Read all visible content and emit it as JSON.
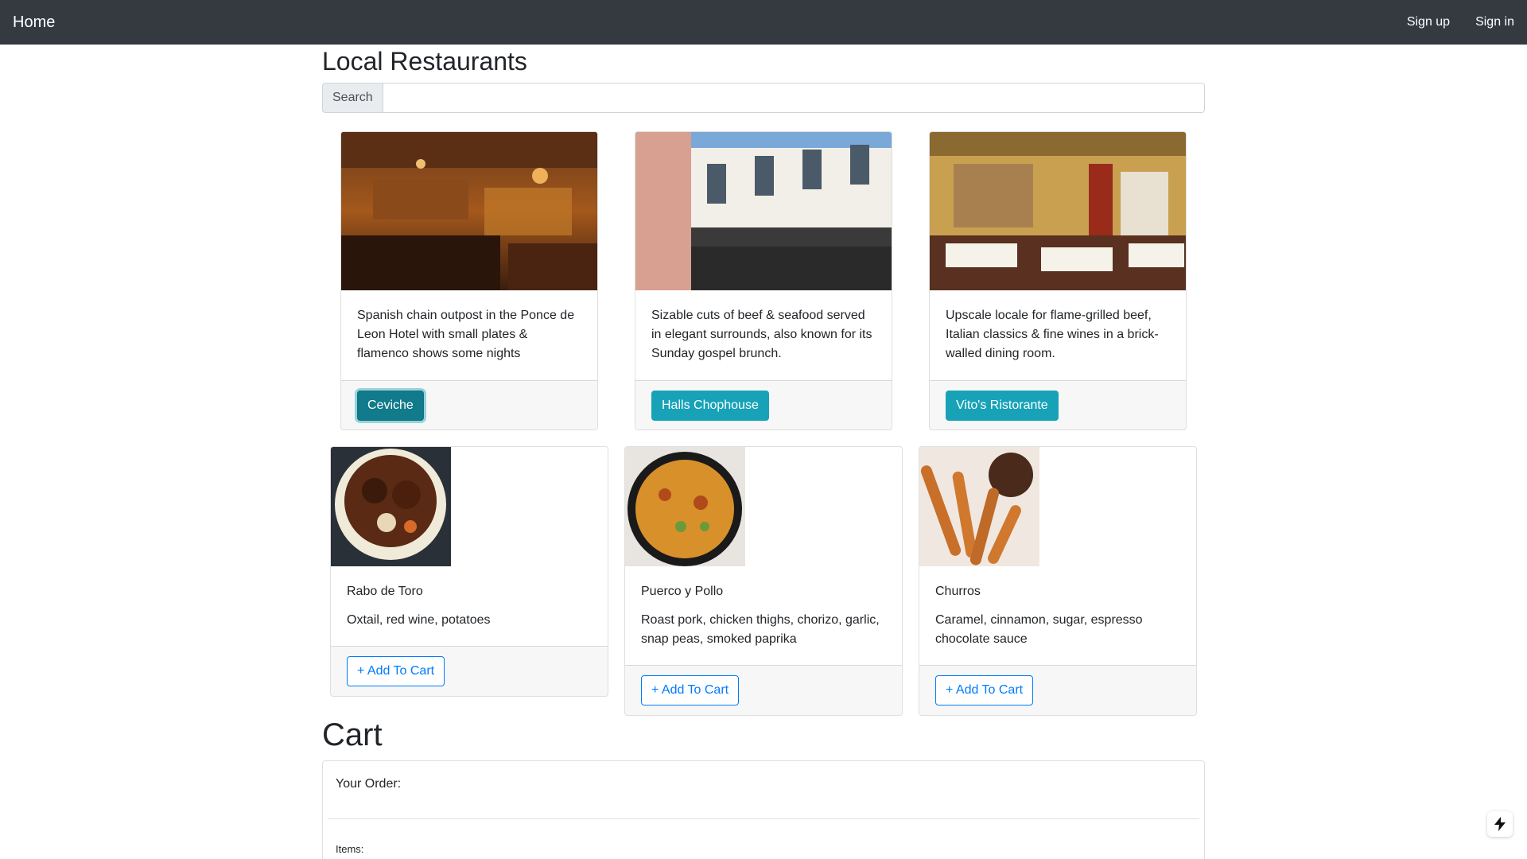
{
  "navbar": {
    "brand": "Home",
    "signup": "Sign up",
    "signin": "Sign in"
  },
  "page": {
    "title": "Local Restaurants"
  },
  "search": {
    "label": "Search",
    "placeholder": "",
    "value": ""
  },
  "restaurants": [
    {
      "image": "restaurant-bar-interior",
      "description": "Spanish chain outpost in the Ponce de Leon Hotel with small plates & flamenco shows some nights",
      "button": "Ceviche"
    },
    {
      "image": "chophouse-storefront",
      "description": "Sizable cuts of beef & seafood served in elegant surrounds, also known for its Sunday gospel brunch.",
      "button": "Halls Chophouse"
    },
    {
      "image": "dining-room-interior",
      "description": "Upscale locale for flame-grilled beef, Italian classics & fine wines in a brick-walled dining room.",
      "button": "Vito's Ristorante"
    }
  ],
  "menu": [
    {
      "image": "oxtail-stew-photo",
      "name": "Rabo de Toro",
      "description": "Oxtail, red wine, potatoes",
      "button": "+ Add To Cart"
    },
    {
      "image": "paella-skillet-photo",
      "name": "Puerco y Pollo",
      "description": "Roast pork, chicken thighs, chorizo, garlic, snap peas, smoked paprika",
      "button": "+ Add To Cart"
    },
    {
      "image": "churros-photo",
      "name": "Churros",
      "description": "Caramel, cinnamon, sugar, espresso chocolate sauce",
      "button": "+ Add To Cart"
    }
  ],
  "cart": {
    "title": "Cart",
    "order_label": "Your Order:",
    "items_label": "Items:"
  },
  "colors": {
    "navbar": "#343a40",
    "info": "#17a2b8",
    "primary": "#007bff"
  }
}
